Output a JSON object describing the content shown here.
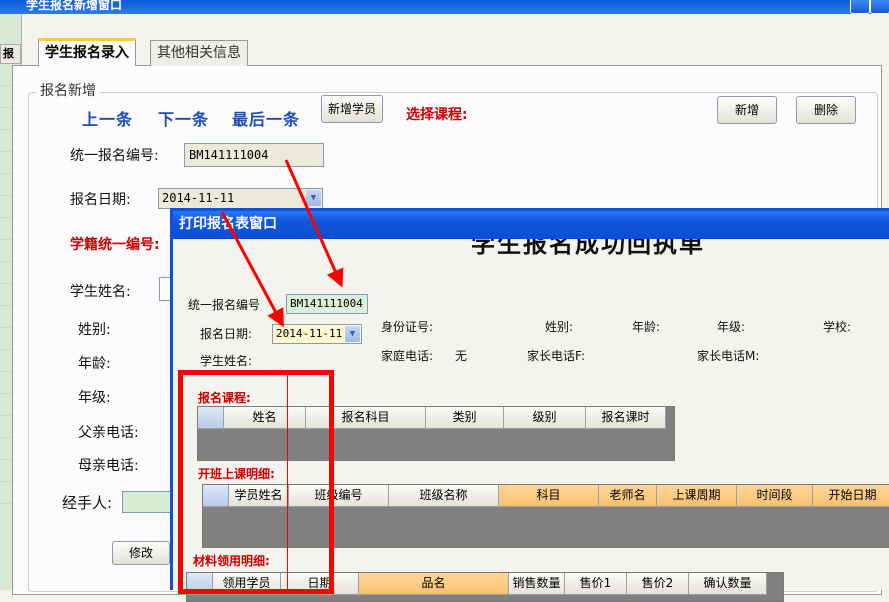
{
  "window": {
    "title": "学生报名新增窗口"
  },
  "left_panel": {
    "header": "报名"
  },
  "tabs": [
    {
      "label": "学生报名录入"
    },
    {
      "label": "其他相关信息"
    }
  ],
  "group": {
    "title": "报名新增"
  },
  "nav": {
    "prev": "上一条",
    "next": "下一条",
    "last": "最后一条"
  },
  "buttons": {
    "add_student": "新增学员",
    "add": "新增",
    "delete": "删除",
    "edit": "修改"
  },
  "course_label": "选择课程:",
  "form": {
    "reg_no_label": "统一报名编号:",
    "reg_no_value": "BM141111004",
    "reg_date_label": "报名日期:",
    "reg_date_value": "2014-11-11",
    "student_no_label": "学籍统一编号:",
    "student_name_label": "学生姓名:",
    "gender_label": "姓别:",
    "age_label": "年龄:",
    "grade_label": "年级:",
    "father_phone_label": "父亲电话:",
    "mother_phone_label": "母亲电话:",
    "handler_label": "经手人:"
  },
  "dialog": {
    "title": "打印报名表窗口",
    "heading": "学生报名成功回执单",
    "reg_no_label": "统一报名编号",
    "reg_no_value": "BM141111004",
    "reg_date_label": "报名日期:",
    "reg_date_value": "2014-11-11",
    "student_name_label": "学生姓名:",
    "id_label": "身份证号:",
    "gender_label": "姓别:",
    "age_label": "年龄:",
    "grade_label": "年级:",
    "school_label": "学校:",
    "home_phone_label": "家庭电话:",
    "home_phone_value": "无",
    "parent_phone_f_label": "家长电话F:",
    "parent_phone_m_label": "家长电话M:",
    "section_courses": "报名课程:",
    "section_classes": "开班上课明细:",
    "section_materials": "材料领用明细:",
    "courses_columns": [
      "姓名",
      "报名科目",
      "类别",
      "级别",
      "报名课时"
    ],
    "classes_columns": [
      "学员姓名",
      "班级编号",
      "班级名称",
      "科目",
      "老师名",
      "上课周期",
      "时间段",
      "开始日期"
    ],
    "materials_columns": [
      "领用学员",
      "日期",
      "品名",
      "销售数量",
      "售价1",
      "售价2",
      "确认数量"
    ]
  },
  "colors": {
    "annotation": "#ff0000",
    "titlebar": "#0a4ed2",
    "nav_link": "#1f4db8",
    "highlight_header": "#f8c070"
  }
}
